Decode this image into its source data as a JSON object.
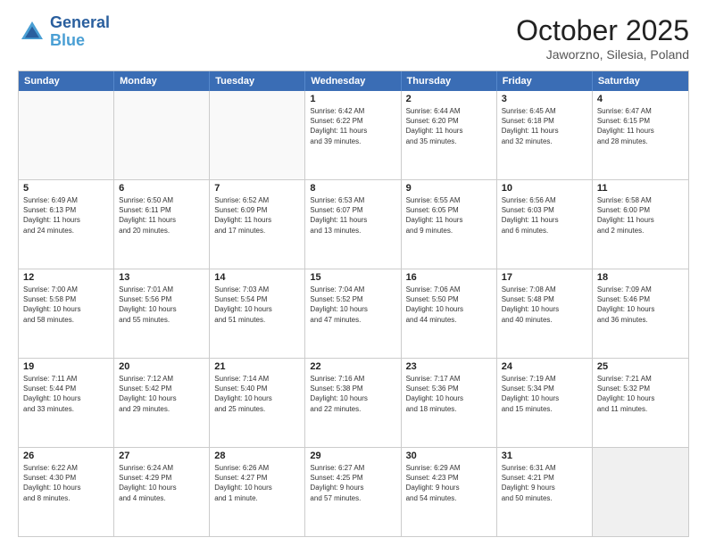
{
  "logo": {
    "line1": "General",
    "line2": "Blue"
  },
  "title": "October 2025",
  "subtitle": "Jaworzno, Silesia, Poland",
  "header_days": [
    "Sunday",
    "Monday",
    "Tuesday",
    "Wednesday",
    "Thursday",
    "Friday",
    "Saturday"
  ],
  "rows": [
    [
      {
        "day": "",
        "lines": [],
        "empty": true
      },
      {
        "day": "",
        "lines": [],
        "empty": true
      },
      {
        "day": "",
        "lines": [],
        "empty": true
      },
      {
        "day": "1",
        "lines": [
          "Sunrise: 6:42 AM",
          "Sunset: 6:22 PM",
          "Daylight: 11 hours",
          "and 39 minutes."
        ]
      },
      {
        "day": "2",
        "lines": [
          "Sunrise: 6:44 AM",
          "Sunset: 6:20 PM",
          "Daylight: 11 hours",
          "and 35 minutes."
        ]
      },
      {
        "day": "3",
        "lines": [
          "Sunrise: 6:45 AM",
          "Sunset: 6:18 PM",
          "Daylight: 11 hours",
          "and 32 minutes."
        ]
      },
      {
        "day": "4",
        "lines": [
          "Sunrise: 6:47 AM",
          "Sunset: 6:15 PM",
          "Daylight: 11 hours",
          "and 28 minutes."
        ]
      }
    ],
    [
      {
        "day": "5",
        "lines": [
          "Sunrise: 6:49 AM",
          "Sunset: 6:13 PM",
          "Daylight: 11 hours",
          "and 24 minutes."
        ]
      },
      {
        "day": "6",
        "lines": [
          "Sunrise: 6:50 AM",
          "Sunset: 6:11 PM",
          "Daylight: 11 hours",
          "and 20 minutes."
        ]
      },
      {
        "day": "7",
        "lines": [
          "Sunrise: 6:52 AM",
          "Sunset: 6:09 PM",
          "Daylight: 11 hours",
          "and 17 minutes."
        ]
      },
      {
        "day": "8",
        "lines": [
          "Sunrise: 6:53 AM",
          "Sunset: 6:07 PM",
          "Daylight: 11 hours",
          "and 13 minutes."
        ]
      },
      {
        "day": "9",
        "lines": [
          "Sunrise: 6:55 AM",
          "Sunset: 6:05 PM",
          "Daylight: 11 hours",
          "and 9 minutes."
        ]
      },
      {
        "day": "10",
        "lines": [
          "Sunrise: 6:56 AM",
          "Sunset: 6:03 PM",
          "Daylight: 11 hours",
          "and 6 minutes."
        ]
      },
      {
        "day": "11",
        "lines": [
          "Sunrise: 6:58 AM",
          "Sunset: 6:00 PM",
          "Daylight: 11 hours",
          "and 2 minutes."
        ]
      }
    ],
    [
      {
        "day": "12",
        "lines": [
          "Sunrise: 7:00 AM",
          "Sunset: 5:58 PM",
          "Daylight: 10 hours",
          "and 58 minutes."
        ]
      },
      {
        "day": "13",
        "lines": [
          "Sunrise: 7:01 AM",
          "Sunset: 5:56 PM",
          "Daylight: 10 hours",
          "and 55 minutes."
        ]
      },
      {
        "day": "14",
        "lines": [
          "Sunrise: 7:03 AM",
          "Sunset: 5:54 PM",
          "Daylight: 10 hours",
          "and 51 minutes."
        ]
      },
      {
        "day": "15",
        "lines": [
          "Sunrise: 7:04 AM",
          "Sunset: 5:52 PM",
          "Daylight: 10 hours",
          "and 47 minutes."
        ]
      },
      {
        "day": "16",
        "lines": [
          "Sunrise: 7:06 AM",
          "Sunset: 5:50 PM",
          "Daylight: 10 hours",
          "and 44 minutes."
        ]
      },
      {
        "day": "17",
        "lines": [
          "Sunrise: 7:08 AM",
          "Sunset: 5:48 PM",
          "Daylight: 10 hours",
          "and 40 minutes."
        ]
      },
      {
        "day": "18",
        "lines": [
          "Sunrise: 7:09 AM",
          "Sunset: 5:46 PM",
          "Daylight: 10 hours",
          "and 36 minutes."
        ]
      }
    ],
    [
      {
        "day": "19",
        "lines": [
          "Sunrise: 7:11 AM",
          "Sunset: 5:44 PM",
          "Daylight: 10 hours",
          "and 33 minutes."
        ]
      },
      {
        "day": "20",
        "lines": [
          "Sunrise: 7:12 AM",
          "Sunset: 5:42 PM",
          "Daylight: 10 hours",
          "and 29 minutes."
        ]
      },
      {
        "day": "21",
        "lines": [
          "Sunrise: 7:14 AM",
          "Sunset: 5:40 PM",
          "Daylight: 10 hours",
          "and 25 minutes."
        ]
      },
      {
        "day": "22",
        "lines": [
          "Sunrise: 7:16 AM",
          "Sunset: 5:38 PM",
          "Daylight: 10 hours",
          "and 22 minutes."
        ]
      },
      {
        "day": "23",
        "lines": [
          "Sunrise: 7:17 AM",
          "Sunset: 5:36 PM",
          "Daylight: 10 hours",
          "and 18 minutes."
        ]
      },
      {
        "day": "24",
        "lines": [
          "Sunrise: 7:19 AM",
          "Sunset: 5:34 PM",
          "Daylight: 10 hours",
          "and 15 minutes."
        ]
      },
      {
        "day": "25",
        "lines": [
          "Sunrise: 7:21 AM",
          "Sunset: 5:32 PM",
          "Daylight: 10 hours",
          "and 11 minutes."
        ]
      }
    ],
    [
      {
        "day": "26",
        "lines": [
          "Sunrise: 6:22 AM",
          "Sunset: 4:30 PM",
          "Daylight: 10 hours",
          "and 8 minutes."
        ]
      },
      {
        "day": "27",
        "lines": [
          "Sunrise: 6:24 AM",
          "Sunset: 4:29 PM",
          "Daylight: 10 hours",
          "and 4 minutes."
        ]
      },
      {
        "day": "28",
        "lines": [
          "Sunrise: 6:26 AM",
          "Sunset: 4:27 PM",
          "Daylight: 10 hours",
          "and 1 minute."
        ]
      },
      {
        "day": "29",
        "lines": [
          "Sunrise: 6:27 AM",
          "Sunset: 4:25 PM",
          "Daylight: 9 hours",
          "and 57 minutes."
        ]
      },
      {
        "day": "30",
        "lines": [
          "Sunrise: 6:29 AM",
          "Sunset: 4:23 PM",
          "Daylight: 9 hours",
          "and 54 minutes."
        ]
      },
      {
        "day": "31",
        "lines": [
          "Sunrise: 6:31 AM",
          "Sunset: 4:21 PM",
          "Daylight: 9 hours",
          "and 50 minutes."
        ]
      },
      {
        "day": "",
        "lines": [],
        "empty": true,
        "shaded": true
      }
    ]
  ]
}
